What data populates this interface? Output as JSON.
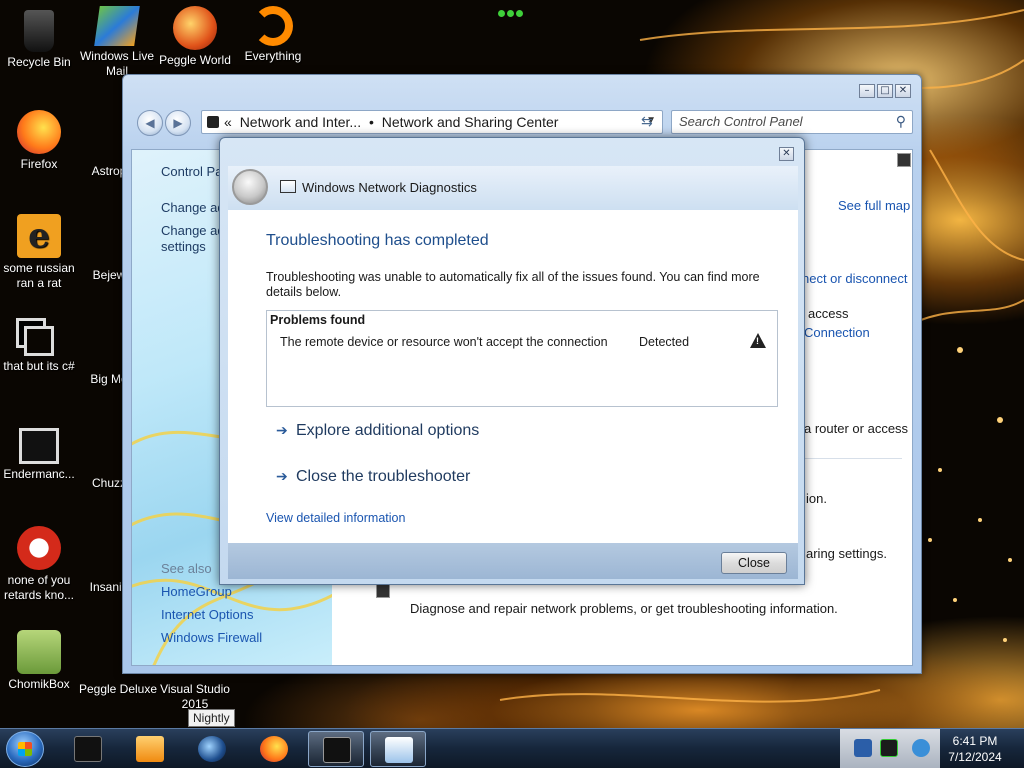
{
  "desktop": {
    "icons": [
      {
        "label": "Recycle Bin"
      },
      {
        "label": "Windows Live Mail"
      },
      {
        "label": "Peggle World"
      },
      {
        "label": "Everything"
      },
      {
        "label": "Firefox"
      },
      {
        "label": "Astrop Delu"
      },
      {
        "label": "some russian ran a rat"
      },
      {
        "label": "Bejew Delu"
      },
      {
        "label": "that but its c#"
      },
      {
        "label": "Big Mo Delu"
      },
      {
        "label": "Endermanc..."
      },
      {
        "label": "Chuzz Delu"
      },
      {
        "label": "none of you retards kno..."
      },
      {
        "label": "Insaniq Delu"
      },
      {
        "label": "ChomikBox"
      },
      {
        "label": "Peggle Deluxe"
      },
      {
        "label": "Visual Studio 2015"
      }
    ]
  },
  "tooltip": {
    "text": "Nightly"
  },
  "control_panel": {
    "address": {
      "crumb1": "«",
      "crumb2": "Network and Inter...",
      "separator": "•",
      "crumb3": "Network and Sharing Center"
    },
    "search_placeholder": "Search Control Panel",
    "sidebar": {
      "links": [
        "Control Panel Home",
        "Change adapter settings",
        "Change advanced sharing settings"
      ],
      "see_also_title": "See also",
      "see_also": [
        "HomeGroup",
        "Internet Options",
        "Windows Firewall"
      ]
    },
    "main_fragments": {
      "see_full_map": "See full map",
      "connect_disconnect": "nect or disconnect",
      "access": "access",
      "connection": "Connection",
      "router": "a router or access",
      "ion": "ion.",
      "sharing": "aring settings.",
      "diagnose": "Diagnose and repair network problems, or get troubleshooting information."
    }
  },
  "dialog": {
    "title": "Windows Network Diagnostics",
    "heading": "Troubleshooting has completed",
    "description": "Troubleshooting was unable to automatically fix all of the issues found. You can find more details below.",
    "problems": {
      "header": "Problems found",
      "items": [
        {
          "description": "The remote device or resource won't accept the connection",
          "status": "Detected",
          "icon": "warning-icon"
        }
      ]
    },
    "options": [
      "Explore additional options",
      "Close the troubleshooter"
    ],
    "detail_link": "View detailed information",
    "close_button": "Close"
  },
  "taskbar": {
    "time": "6:41 PM",
    "date": "7/12/2024"
  }
}
